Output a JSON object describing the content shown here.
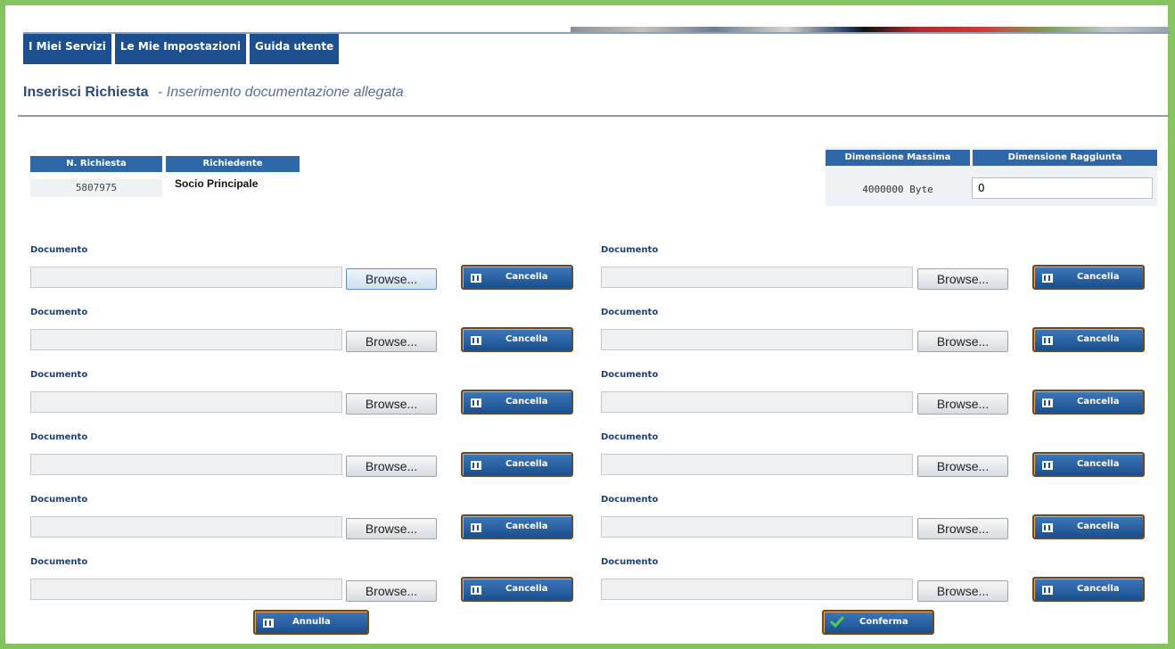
{
  "nav": {
    "tabs": [
      {
        "label": "I Miei Servizi"
      },
      {
        "label": "Le Mie Impostazioni"
      },
      {
        "label": "Guida utente"
      }
    ]
  },
  "page": {
    "title": "Inserisci Richiesta",
    "separator": "-",
    "subtitle": "Inserimento documentazione allegata"
  },
  "request": {
    "number_header": "N. Richiesta",
    "applicant_header": "Richiedente",
    "number": "5807975",
    "applicant": "Socio Principale"
  },
  "size": {
    "max_header": "Dimensione Massima",
    "reached_header": "Dimensione Raggiunta",
    "max_value": "4000000 Byte",
    "reached_value": "0"
  },
  "documents": {
    "label": "Documento",
    "browse_label": "Browse...",
    "cancel_label": "Cancella",
    "rows": 6
  },
  "footer": {
    "annulla_label": "Annulla",
    "conferma_label": "Conferma"
  },
  "colors": {
    "frame_border": "#86c35f",
    "nav_bg": "#1d4f8f",
    "header_bg": "#2e67a8",
    "title": "#2b4a7a"
  }
}
